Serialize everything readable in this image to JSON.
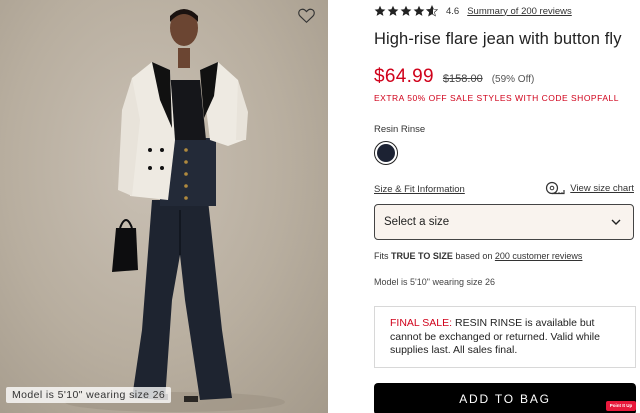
{
  "product": {
    "image_alt": "Model wearing high-rise flare jean with white tuxedo blazer",
    "model_caption": "Model is 5'10\" wearing size 26",
    "rating": "4.6",
    "rating_fraction": 0.92,
    "reviews_link": "Summary of 200 reviews",
    "title": "High-rise flare jean with button fly",
    "sale_price": "$64.99",
    "original_price": "$158.00",
    "percent_off": "(59% Off)",
    "promo": "EXTRA 50% OFF SALE STYLES WITH CODE SHOPFALL",
    "color_label": "Resin Rinse",
    "swatch_color": "#1c2233",
    "size_fit_link": "Size & Fit Information",
    "size_chart_link": "View size chart",
    "size_select_placeholder": "Select a size",
    "fits_prefix": "Fits ",
    "fits_value": "TRUE TO SIZE",
    "fits_middle": " based on ",
    "fits_link": "200 customer reviews",
    "model_info": "Model is 5'10\" wearing size 26",
    "final_sale_label": "FINAL SALE:",
    "final_sale_text": " RESIN RINSE is available but cannot be exchanged or returned. Valid while supplies last. All sales final.",
    "add_to_bag": "ADD TO BAG",
    "fab_label": "Point It Up"
  },
  "colors": {
    "sale_red": "#d0021b",
    "button_black": "#000000",
    "select_bg": "#f9f3ee"
  },
  "icons": {
    "wishlist": "heart-outline-icon",
    "size_chart": "measuring-tape-icon",
    "dropdown": "chevron-down-icon",
    "star": "star-icon"
  }
}
